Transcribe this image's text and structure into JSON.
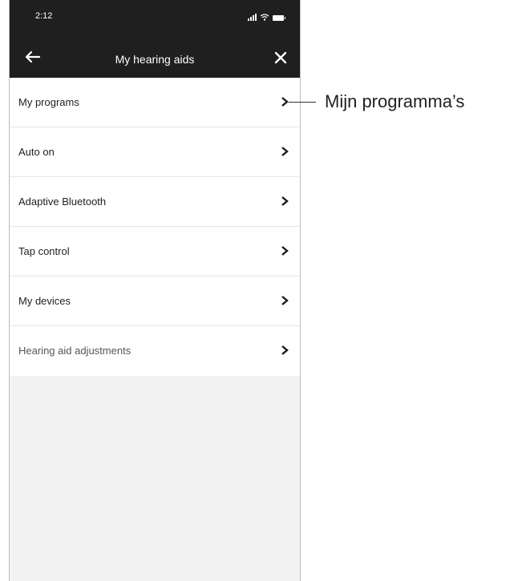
{
  "status_bar": {
    "time": "2:12"
  },
  "nav": {
    "title": "My hearing aids",
    "back_icon": "arrow-left-icon",
    "close_icon": "close-icon"
  },
  "menu": {
    "items": [
      {
        "label": "My programs"
      },
      {
        "label": "Auto on"
      },
      {
        "label": "Adaptive Bluetooth"
      },
      {
        "label": "Tap control"
      },
      {
        "label": "My devices"
      },
      {
        "label": "Hearing aid adjustments"
      }
    ]
  },
  "callout": {
    "text": "Mijn programma’s"
  },
  "colors": {
    "header_bg": "#1f1f1f",
    "list_bg": "#ffffff",
    "screen_bg": "#f2f2f2"
  }
}
